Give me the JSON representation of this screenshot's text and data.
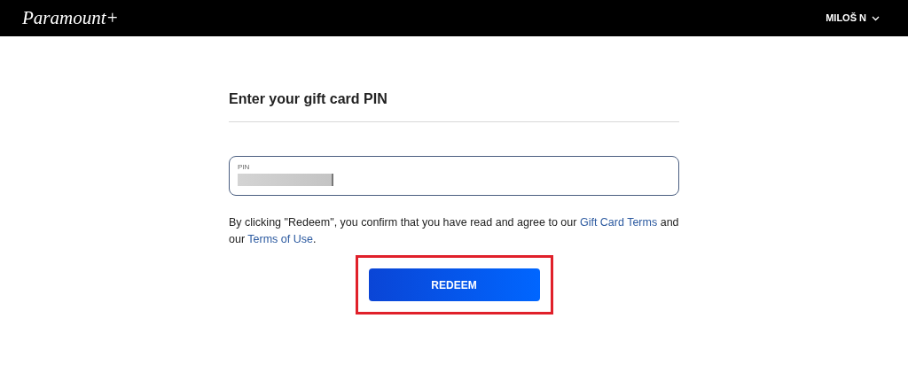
{
  "header": {
    "logo": "Paramount+",
    "account": {
      "name": "MILOŠ N",
      "expanded": false
    }
  },
  "form": {
    "title": "Enter your gift card PIN",
    "pin_field": {
      "label": "PIN",
      "value_redacted": true
    },
    "consent": [
      {
        "kind": "text",
        "text": "By clicking \"Redeem\", you confirm that you have read and agree to our "
      },
      {
        "kind": "link",
        "text": "Gift Card Terms"
      },
      {
        "kind": "text",
        "text": " and our "
      },
      {
        "kind": "link",
        "text": "Terms of Use"
      },
      {
        "kind": "text",
        "text": "."
      }
    ],
    "button": {
      "label": "REDEEM",
      "highlighted": true
    }
  }
}
